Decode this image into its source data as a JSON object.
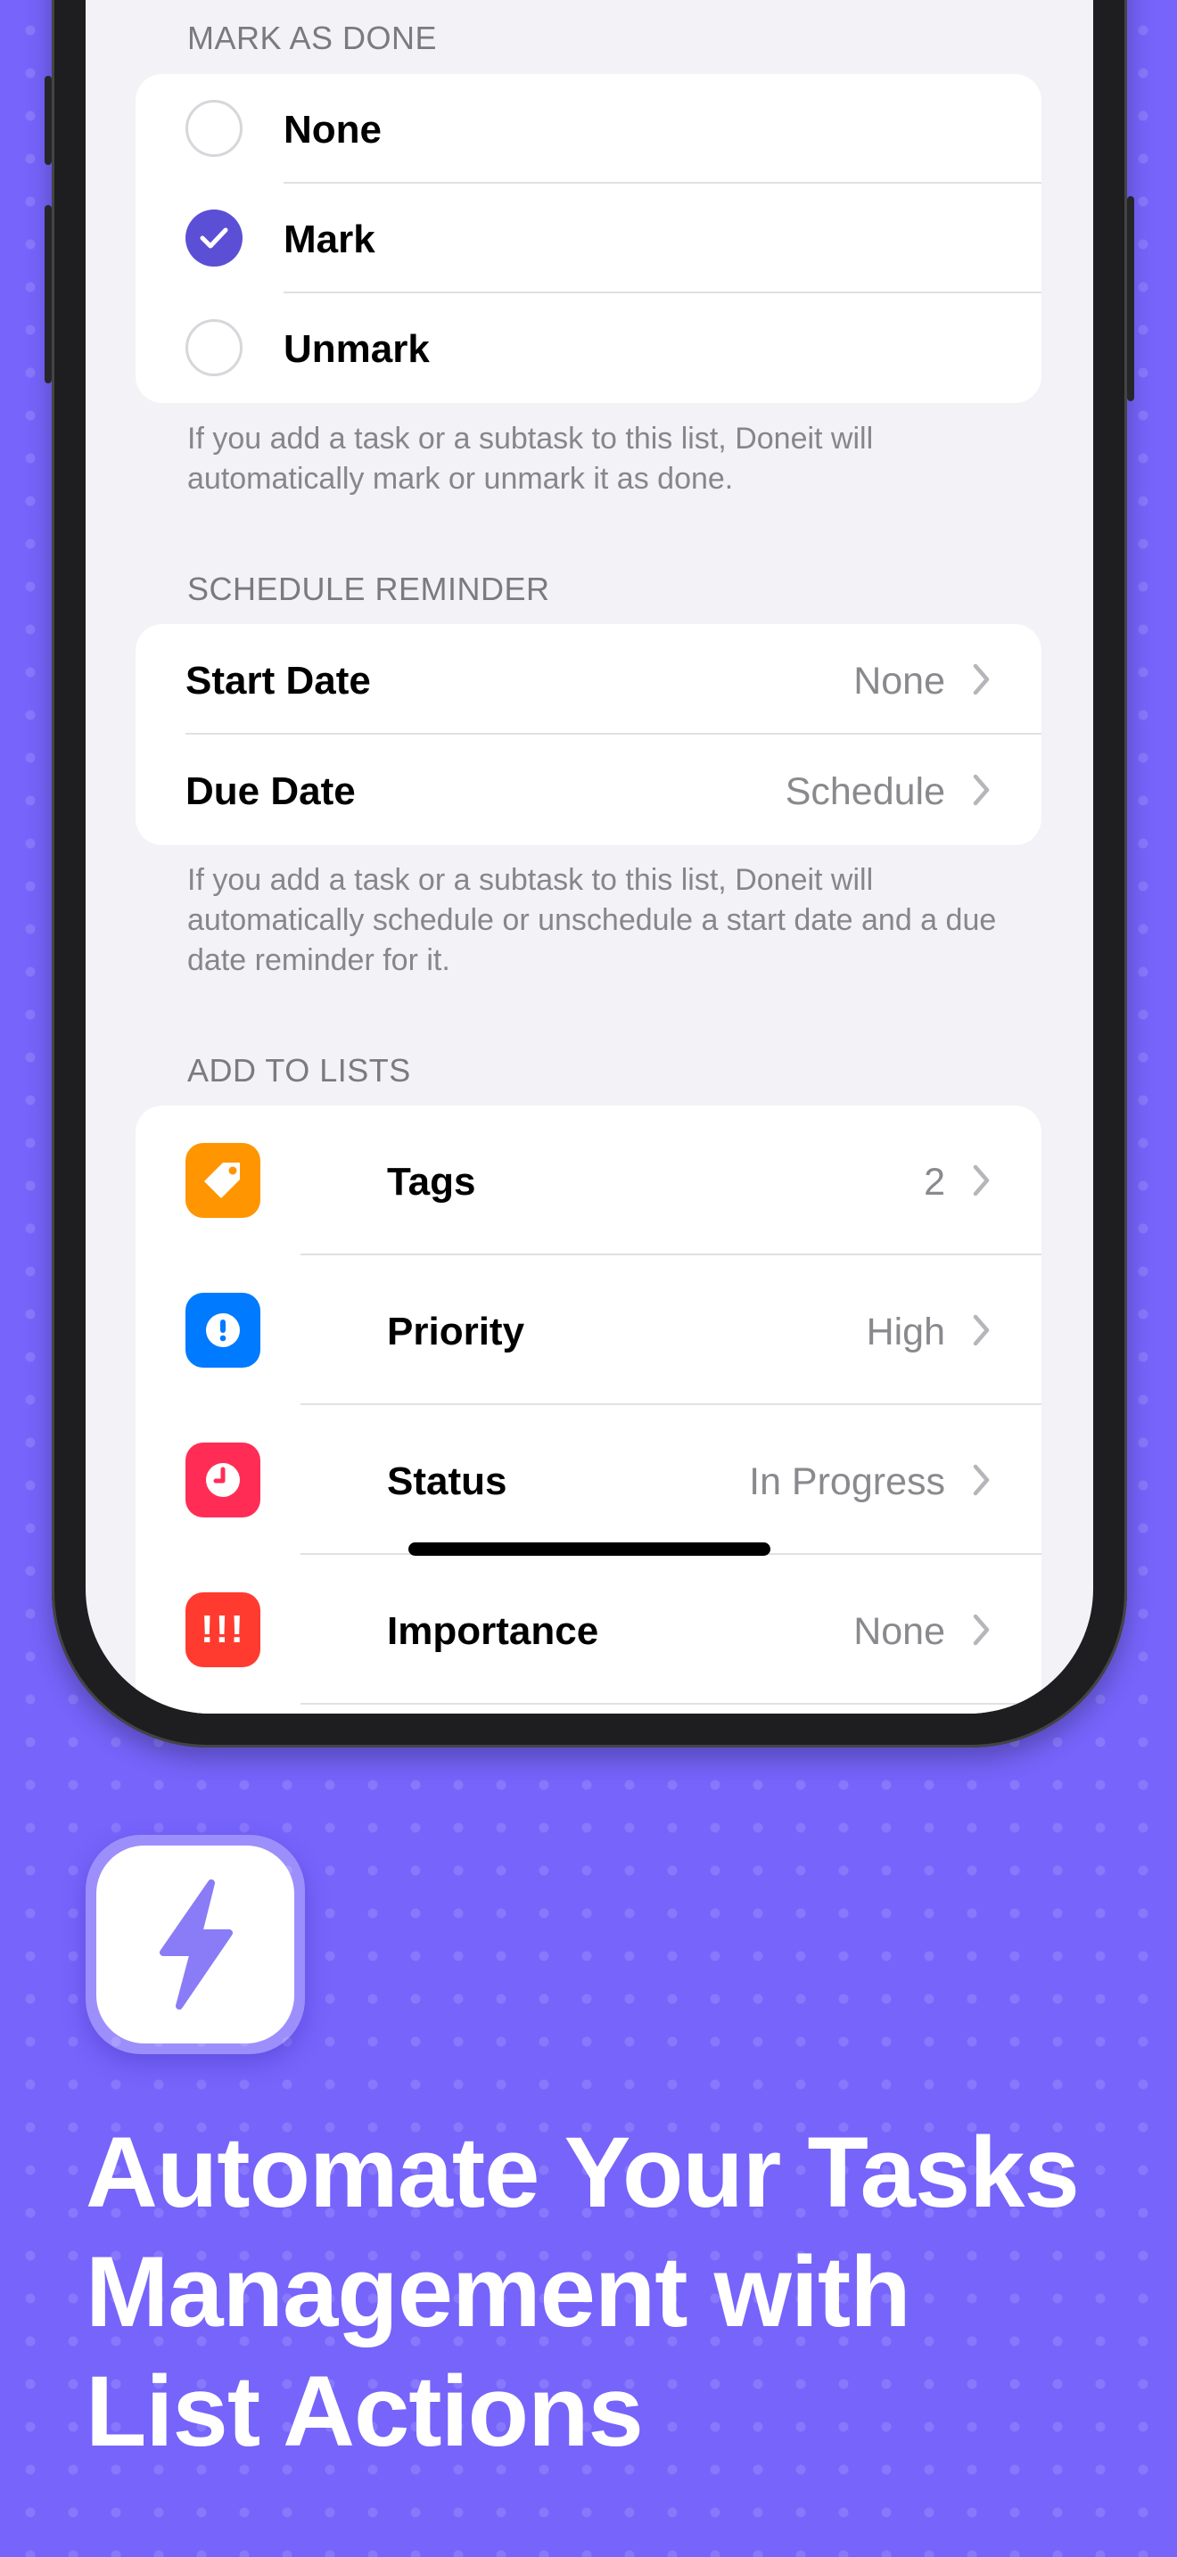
{
  "mark_as_done": {
    "header": "MARK AS DONE",
    "options": [
      {
        "label": "None",
        "selected": false
      },
      {
        "label": "Mark",
        "selected": true
      },
      {
        "label": "Unmark",
        "selected": false
      }
    ],
    "footer": "If you add a task or a subtask to this list, Doneit will automatically mark or unmark it as done."
  },
  "schedule_reminder": {
    "header": "SCHEDULE REMINDER",
    "rows": [
      {
        "label": "Start Date",
        "value": "None"
      },
      {
        "label": "Due Date",
        "value": "Schedule"
      }
    ],
    "footer": "If you add a task or a subtask to this list, Doneit will automatically schedule or unschedule a start date and a due date reminder for it."
  },
  "add_to_lists": {
    "header": "ADD TO LISTS",
    "rows": [
      {
        "label": "Tags",
        "value": "2",
        "icon": "tag-icon",
        "color": "#ff9500"
      },
      {
        "label": "Priority",
        "value": "High",
        "icon": "exclamation-circle-icon",
        "color": "#007aff"
      },
      {
        "label": "Status",
        "value": "In Progress",
        "icon": "clock-icon",
        "color": "#ff2d55"
      },
      {
        "label": "Importance",
        "value": "None",
        "icon": "triple-exclamation-icon",
        "color": "#ff3b30",
        "icon_text": "!!!"
      }
    ]
  },
  "promo": {
    "icon": "lightning-bolt-icon",
    "headline_lines": [
      "Automate Your Tasks",
      "Management with",
      "List Actions"
    ]
  },
  "colors": {
    "background": "#7664fb",
    "accent": "#5b4fd6",
    "bolt": "#8a7bf7"
  }
}
